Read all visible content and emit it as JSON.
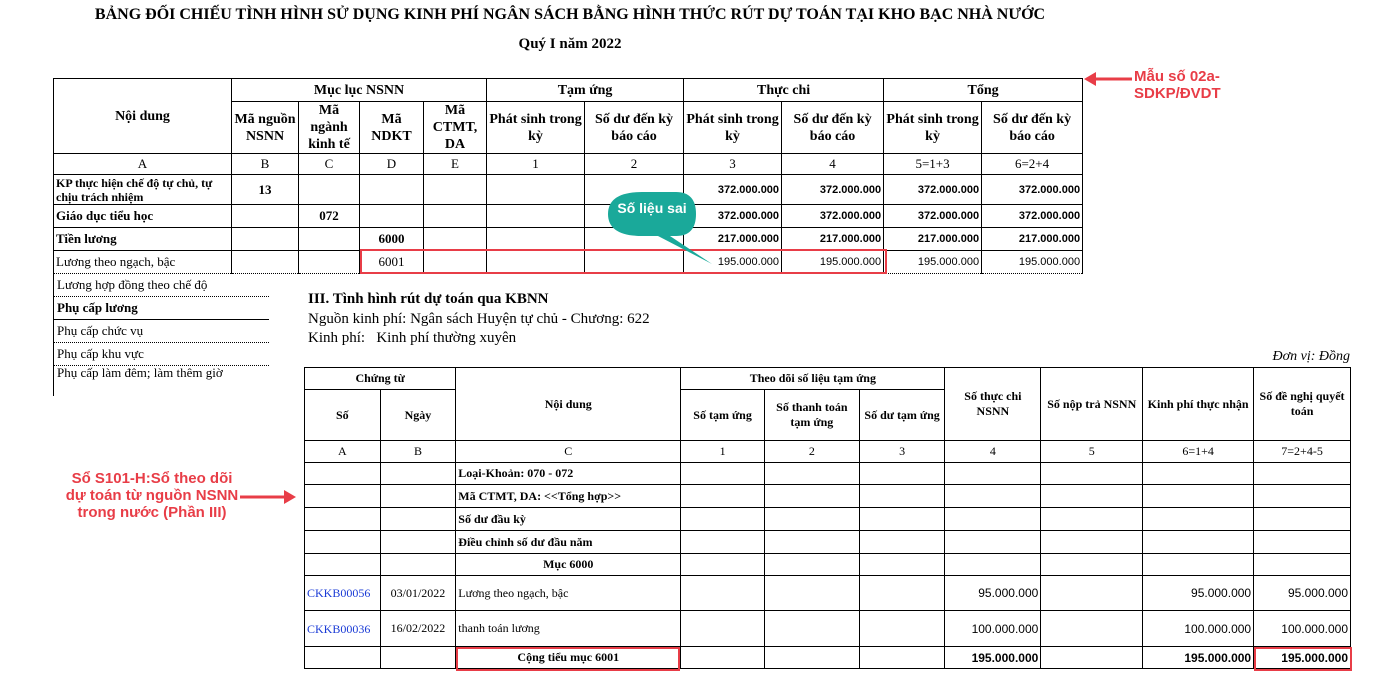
{
  "title": "BẢNG ĐỐI CHIẾU TÌNH HÌNH SỬ DỤNG KINH PHÍ NGÂN SÁCH BẰNG HÌNH THỨC RÚT DỰ TOÁN TẠI KHO BẠC NHÀ NƯỚC",
  "subtitle": "Quý I năm 2022",
  "top_table": {
    "col_noi_dung": "Nội dung",
    "group_muc_luc": "Mục lục NSNN",
    "group_tam_ung": "Tạm ứng",
    "group_thuc_chi": "Thực chi",
    "group_tong": "Tổng",
    "ma_nguon": "Mã nguồn NSNN",
    "ma_nganh": "Mã ngành kinh tế",
    "ma_ndkt": "Mã NDKT",
    "ma_ctmt": "Mã CTMT, DA",
    "phat_sinh": "Phát sinh trong kỳ",
    "so_du": "Số dư đến kỳ báo cáo",
    "index": [
      "A",
      "B",
      "C",
      "D",
      "E",
      "1",
      "2",
      "3",
      "4",
      "5=1+3",
      "6=2+4"
    ],
    "rows": [
      {
        "name": "KP thực hiện chế độ tự chủ, tự chịu trách nhiệm",
        "b": "13",
        "c": "",
        "d": "",
        "v3": "372.000.000",
        "v4": "372.000.000",
        "v5": "372.000.000",
        "v6": "372.000.000"
      },
      {
        "name": "Giáo dục tiểu học",
        "b": "",
        "c": "072",
        "d": "",
        "v3": "372.000.000",
        "v4": "372.000.000",
        "v5": "372.000.000",
        "v6": "372.000.000"
      },
      {
        "name": "Tiền lương",
        "b": "",
        "c": "",
        "d": "6000",
        "v3": "217.000.000",
        "v4": "217.000.000",
        "v5": "217.000.000",
        "v6": "217.000.000"
      },
      {
        "name": "Lương theo ngạch, bậc",
        "b": "",
        "c": "",
        "d": "6001",
        "v3": "195.000.000",
        "v4": "195.000.000",
        "v5": "195.000.000",
        "v6": "195.000.000"
      }
    ],
    "extra_rows": [
      "Lương hợp đồng theo chế độ",
      "Phụ cấp lương",
      "Phụ cấp chức vụ",
      "Phụ cấp khu vực",
      "Phụ cấp làm đêm; làm thêm giờ"
    ]
  },
  "callout_top": "Mẫu số 02a-SDKP/ĐVDT",
  "bubble": "Số liệu sai",
  "section": {
    "heading": "III. Tình hình rút dự toán qua KBNN",
    "source": "Nguồn kinh phí: Ngân sách Huyện tự chủ - Chương: 622",
    "funding": "Kinh phí:   Kinh phí thường xuyên",
    "unit": "Đơn vị: Đồng"
  },
  "bottom_table": {
    "chung_tu": "Chứng từ",
    "so": "Số",
    "ngay": "Ngày",
    "noi_dung": "Nội dung",
    "theo_doi": "Theo dõi số liệu tạm ứng",
    "so_tam_ung": "Số tạm ứng",
    "so_thanh_toan": "Số thanh toán tạm ứng",
    "so_du_tam_ung": "Số dư tạm ứng",
    "so_thuc_chi": "Số thực chi NSNN",
    "so_nop_tra": "Số nộp trả NSNN",
    "kinh_phi": "Kinh phí thực nhận",
    "de_nghi": "Số đề nghị quyết toán",
    "index": [
      "A",
      "B",
      "C",
      "1",
      "2",
      "3",
      "4",
      "5",
      "6=1+4",
      "7=2+4-5"
    ],
    "label_rows": [
      "Loại-Khoản: 070 - 072",
      "Mã CTMT, DA: <<Tổng hợp>>",
      "Số dư đầu kỳ",
      "Điều chỉnh số dư đầu năm"
    ],
    "muc": "Mục 6000",
    "entries": [
      {
        "so": "CKKB00056",
        "ngay": "03/01/2022",
        "noi_dung": "Lương theo ngạch, bậc",
        "thuc_chi": "95.000.000",
        "kinh_phi": "95.000.000",
        "de_nghi": "95.000.000"
      },
      {
        "so": "CKKB00036",
        "ngay": "16/02/2022",
        "noi_dung": "thanh toán lương",
        "thuc_chi": "100.000.000",
        "kinh_phi": "100.000.000",
        "de_nghi": "100.000.000"
      }
    ],
    "subtotal": {
      "label": "Cộng tiểu mục 6001",
      "thuc_chi": "195.000.000",
      "kinh_phi": "195.000.000",
      "de_nghi": "195.000.000"
    }
  },
  "callout_left": "Sổ S101-H:Sổ theo dõi dự toán từ nguồn NSNN trong nước (Phần III)"
}
